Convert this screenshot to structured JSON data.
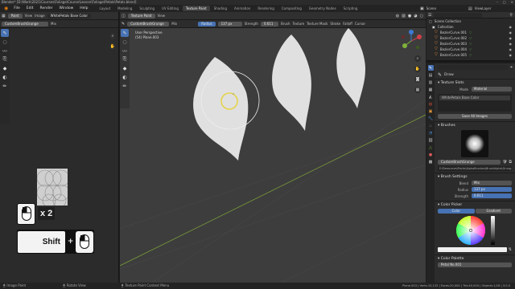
{
  "titlebar": {
    "text": "Blender* [D:\\Work\\2021\\Courses\\Foliage\\Course\\Lesson\\Foliage\\Petals\\Petals.blend]"
  },
  "menubar": {
    "items": [
      "File",
      "Edit",
      "Render",
      "Window",
      "Help"
    ],
    "workspaces": [
      "Layout",
      "Modeling",
      "Sculpting",
      "UV Editing",
      "Texture Paint",
      "Shading",
      "Animation",
      "Rendering",
      "Compositing",
      "Geometry Nodes",
      "Scripting"
    ],
    "active_workspace": "Texture Paint",
    "scene_label": "Scene",
    "viewlayer_label": "ViewLayer"
  },
  "image_editor": {
    "header": {
      "mode": "Paint",
      "view": "View",
      "image": "Image",
      "image_name": "WhitePetals Base Color"
    },
    "toolheader": {
      "brush": "CustomBrushGrunge",
      "blend": "Mix"
    }
  },
  "viewport": {
    "header": {
      "editor": "Texture Paint",
      "view": "View"
    },
    "toolheader": {
      "brush": "CustomBrushGrunge",
      "blend": "Mix",
      "color_label": "Radius",
      "radius_value": "137 px",
      "strength_label": "Strength",
      "strength_value": "0.611",
      "items": [
        "Brush",
        "Texture",
        "Texture Mask",
        "Stroke",
        "Falloff",
        "Cursor"
      ]
    },
    "overlay": {
      "line1": "User Perspective",
      "line2": "(54) Plane.003"
    }
  },
  "mouse_hints": {
    "double_click": "x 2",
    "shift_key": "Shift",
    "plus": "+"
  },
  "outliner": {
    "header": "Scene Collection",
    "items": [
      {
        "label": "Collection",
        "type": "collection"
      },
      {
        "label": "BezierCurve.001"
      },
      {
        "label": "BezierCurve.002"
      },
      {
        "label": "BezierCurve.003"
      },
      {
        "label": "BezierCurve.004"
      },
      {
        "label": "BezierCurve.005"
      },
      {
        "label": "BezierCurve.007"
      }
    ]
  },
  "properties": {
    "search_placeholder": "Draw",
    "tool_name": "Draw",
    "texture_slots": {
      "label": "Texture Slots",
      "mode_label": "Mode",
      "mode_value": "Material",
      "slot_name": "WhitePetals Base Color",
      "save_all": "Save All Images"
    },
    "brushes": {
      "label": "Brushes",
      "brush_name": "CustomBrushGrunge",
      "filepath": "E:\\Resources\\Packs\\AlphaBrushes\\BrushAlpha\\Grung..."
    },
    "brush_settings": {
      "label": "Brush Settings",
      "blend_label": "Blend",
      "blend_value": "Mix",
      "radius_label": "Radius",
      "radius_value": "137 px",
      "strength_label": "Strength",
      "strength_value": "0.611"
    },
    "color_picker": {
      "label": "Color Picker",
      "tab_color": "Color",
      "tab_gradient": "Gradient"
    },
    "color_palette": {
      "label": "Color Palette",
      "palette_name": "Petal No.001"
    }
  },
  "statusbar": {
    "left": "Image Paint",
    "middle": "Rotate View",
    "center": "Texture Paint Context Menu",
    "right": "Plane.003 | Verts:10,125 | Faces:20,000 | Tris:40,000 | Objects:1/18 | 3.0.0"
  },
  "colors": {
    "accent": "#4772b3",
    "viewport_bg": "#3d3d3d",
    "petal": "#e3e3e3",
    "gridline": "#7a9a3a",
    "brush_ring": "#e6d34a"
  }
}
